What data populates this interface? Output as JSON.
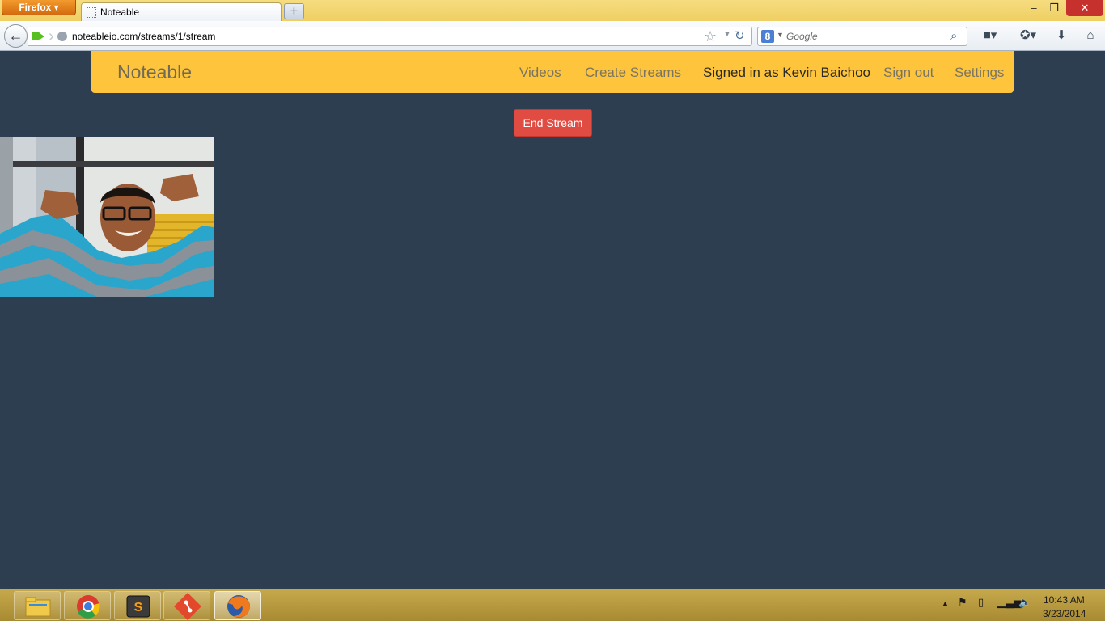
{
  "browser": {
    "menu_label": "Firefox ▾",
    "tab_title": "Noteable",
    "new_tab_glyph": "+",
    "url": "noteableio.com/streams/1/stream",
    "search_placeholder": "Google",
    "window_buttons": {
      "minimize": "–",
      "restore": "❐",
      "close": "✕"
    }
  },
  "site": {
    "brand": "Noteable",
    "nav": {
      "videos": "Videos",
      "create_streams": "Create Streams",
      "signed_in": "Signed in as Kevin Baichoo",
      "sign_out": "Sign out",
      "settings": "Settings"
    },
    "end_stream_label": "End Stream",
    "colors": {
      "page_background": "#2c3e50",
      "navbar_background": "#fec43b",
      "end_button": "#e04b42"
    }
  },
  "taskbar": {
    "apps": [
      "file-explorer-icon",
      "chrome-icon",
      "sublime-text-icon",
      "git-icon",
      "firefox-icon"
    ],
    "clock_time": "10:43 AM",
    "clock_date": "3/23/2014"
  }
}
